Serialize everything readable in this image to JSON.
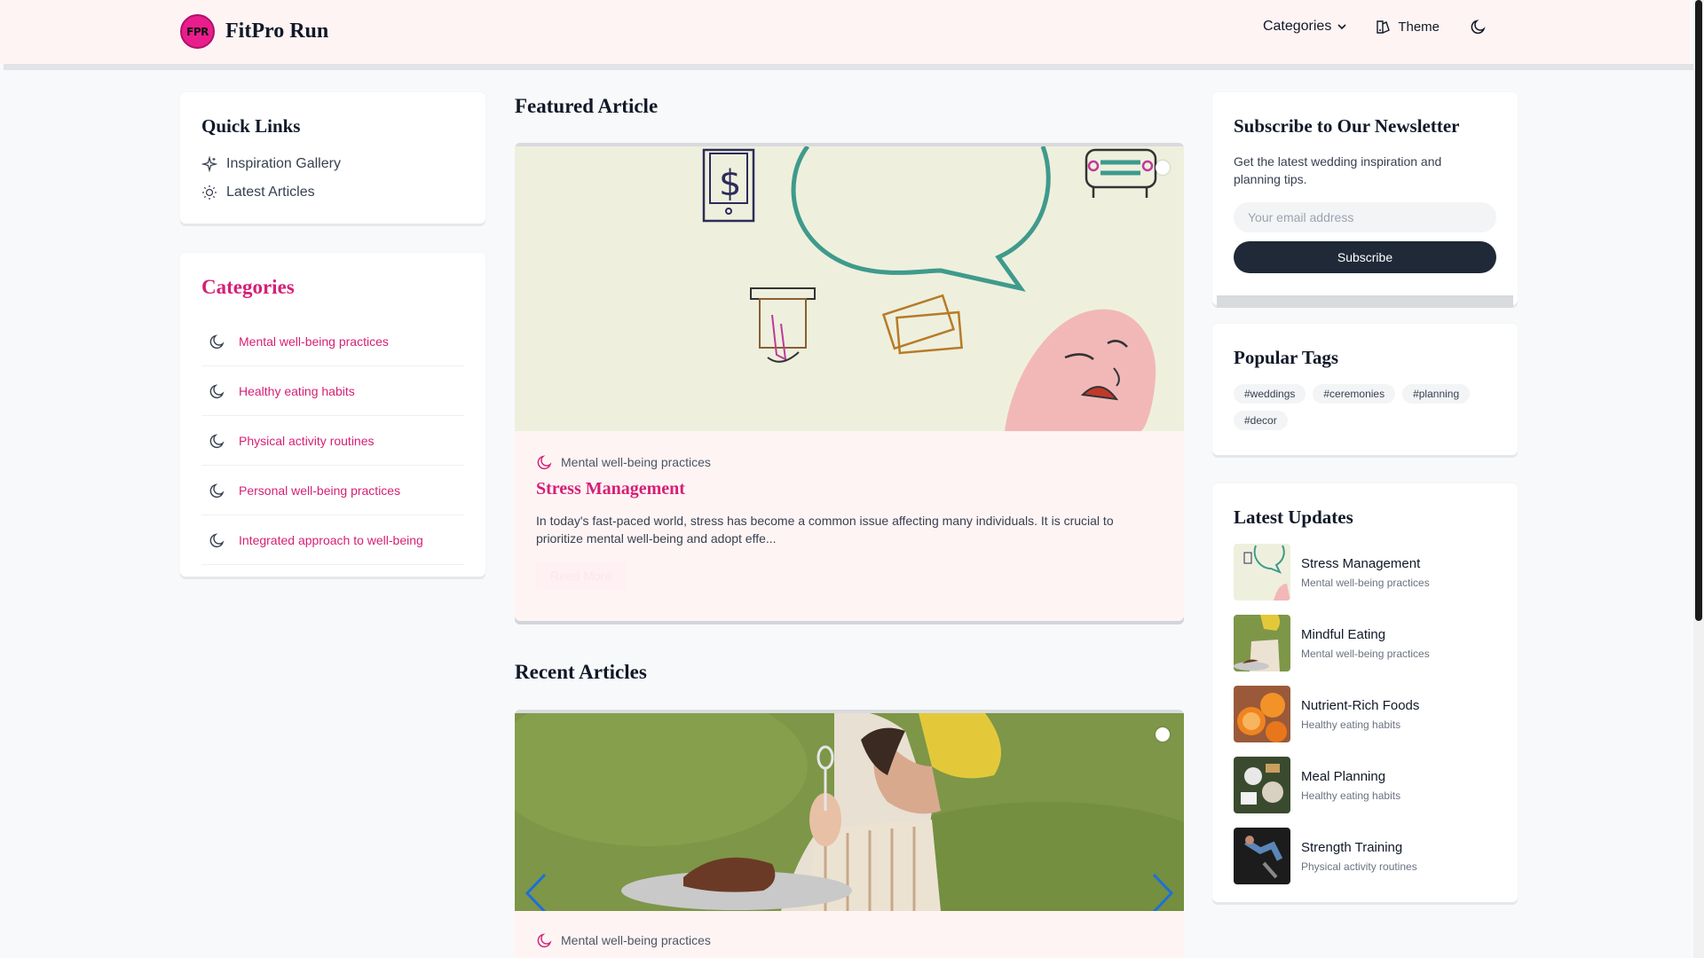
{
  "header": {
    "logo_text": "FPR",
    "brand": "FitPro Run",
    "nav_categories": "Categories",
    "nav_theme": "Theme"
  },
  "quick_links": {
    "title": "Quick Links",
    "items": [
      {
        "label": "Inspiration Gallery",
        "icon": "sparkles-icon"
      },
      {
        "label": "Latest Articles",
        "icon": "sun-icon"
      }
    ]
  },
  "categories": {
    "title": "Categories",
    "items": [
      {
        "label": "Mental well-being practices",
        "icon": "moon-icon"
      },
      {
        "label": "Healthy eating habits",
        "icon": "moon-icon"
      },
      {
        "label": "Physical activity routines",
        "icon": "moon-icon"
      },
      {
        "label": "Personal well-being practices",
        "icon": "moon-icon"
      },
      {
        "label": "Integrated approach to well-being",
        "icon": "moon-icon"
      }
    ]
  },
  "featured": {
    "section_title": "Featured Article",
    "category": "Mental well-being practices",
    "title": "Stress Management",
    "excerpt": "In today's fast-paced world, stress has become a common issue affecting many individuals. It is crucial to prioritize mental well-being and adopt effe...",
    "read_more": "Read More"
  },
  "recent": {
    "section_title": "Recent Articles",
    "category": "Mental well-being practices"
  },
  "newsletter": {
    "title": "Subscribe to Our Newsletter",
    "description": "Get the latest wedding inspiration and planning tips.",
    "email_placeholder": "Your email address",
    "button": "Subscribe"
  },
  "popular_tags": {
    "title": "Popular Tags",
    "tags": [
      "#weddings",
      "#ceremonies",
      "#planning",
      "#decor"
    ]
  },
  "latest_updates": {
    "title": "Latest Updates",
    "items": [
      {
        "title": "Stress Management",
        "category": "Mental well-being practices"
      },
      {
        "title": "Mindful Eating",
        "category": "Mental well-being practices"
      },
      {
        "title": "Nutrient-Rich Foods",
        "category": "Healthy eating habits"
      },
      {
        "title": "Meal Planning",
        "category": "Healthy eating habits"
      },
      {
        "title": "Strength Training",
        "category": "Physical activity routines"
      }
    ]
  },
  "colors": {
    "accent": "#d61f76",
    "header_bg": "#fff4f4",
    "button_dark": "#1f2937"
  }
}
